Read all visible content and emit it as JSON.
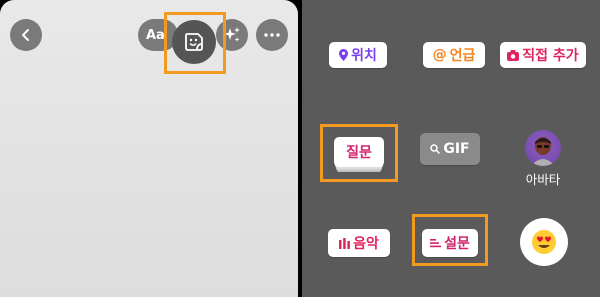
{
  "editor": {
    "text_tool_label": "Aa",
    "icons": {
      "back": "chevron-left-icon",
      "sticker": "sticker-icon",
      "effects": "sparkles-icon",
      "more": "more-horizontal-icon"
    }
  },
  "stickers": {
    "location": "위치",
    "mention": "언급",
    "photo": "직접 추가",
    "question": "질문",
    "gif": "GIF",
    "avatar": "아바타",
    "music": "음악",
    "poll": "설문"
  },
  "colors": {
    "highlight": "#f19a1f",
    "tray_bg": "#5a5a5a",
    "location": "#7b3ff2",
    "mention": "#f5841f",
    "photo": "#e0245e",
    "question": "#d2246e"
  }
}
